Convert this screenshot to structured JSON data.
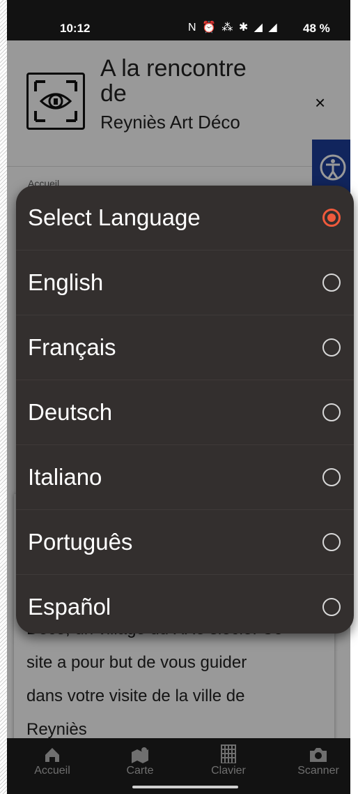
{
  "status_bar": {
    "time": "10:12",
    "icons": "N ⏰ ⁂ ✱ ◢ ◢",
    "battery": "48 %"
  },
  "header": {
    "title_line1": "A la rencontre",
    "title_line2": "de",
    "title_line3": "Reyniès Art Déco",
    "close_label": "×"
  },
  "breadcrumb": "Accueil",
  "content": {
    "lines": [
      "Déco, un village du XXe siècle. Ce",
      "site a pour but de vous guider",
      "dans votre visite de la ville de",
      "Reyniès"
    ]
  },
  "language_dialog": {
    "options": [
      {
        "label": "Select Language",
        "selected": true
      },
      {
        "label": "English",
        "selected": false
      },
      {
        "label": "Français",
        "selected": false
      },
      {
        "label": "Deutsch",
        "selected": false
      },
      {
        "label": "Italiano",
        "selected": false
      },
      {
        "label": "Português",
        "selected": false
      },
      {
        "label": "Español",
        "selected": false
      }
    ],
    "accent_color": "#f05a3c"
  },
  "nav": {
    "items": [
      {
        "label": "Accueil",
        "icon": "home-icon"
      },
      {
        "label": "Carte",
        "icon": "map-icon"
      },
      {
        "label": "Clavier",
        "icon": "keypad-icon"
      },
      {
        "label": "Scanner",
        "icon": "camera-icon"
      }
    ]
  }
}
